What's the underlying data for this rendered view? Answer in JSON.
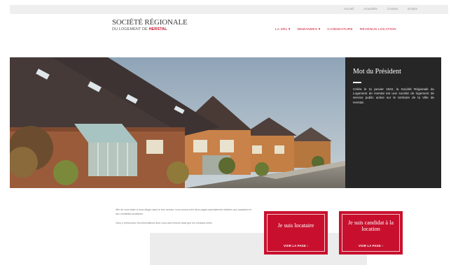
{
  "topbar": {
    "links": [
      "Accueil",
      "Actualités",
      "Contact",
      "Emploi"
    ]
  },
  "logo": {
    "line1": "SOCIÉTÉ RÉGIONALE",
    "line2_prefix": "DU LOGEMENT DE",
    "line2_brand": "HERSTAL"
  },
  "nav": {
    "items": [
      "LA SRL ▾",
      "DEMANDES ▾",
      "CANDIDATURE",
      "REVENUS LOCATION"
    ]
  },
  "president": {
    "title": "Mot du Président",
    "text": "Créée le 11 janvier 1922, la Société Régionale du Logement de Herstal est une société de logement de service public active sur le territoire de la Ville de Herstal."
  },
  "intro": {
    "p1": "Afin de vous aider à vous diriger dans le bon service, nous avons créé deux pages spécialement dédiées aux locataires et aux candidats-locataires.",
    "p2": "Vous y retrouverez les informations dont vous avez besoin ainsi que les contacts utiles."
  },
  "cta": {
    "tenant": {
      "title": "Je suis locataire",
      "button": "VOIR LA PAGE ›"
    },
    "candidate": {
      "title": "Je suis candidat à la location",
      "button": "VOIR LA PAGE ›"
    }
  },
  "colors": {
    "brand_red": "#c8102e",
    "panel_dark": "#262626"
  }
}
